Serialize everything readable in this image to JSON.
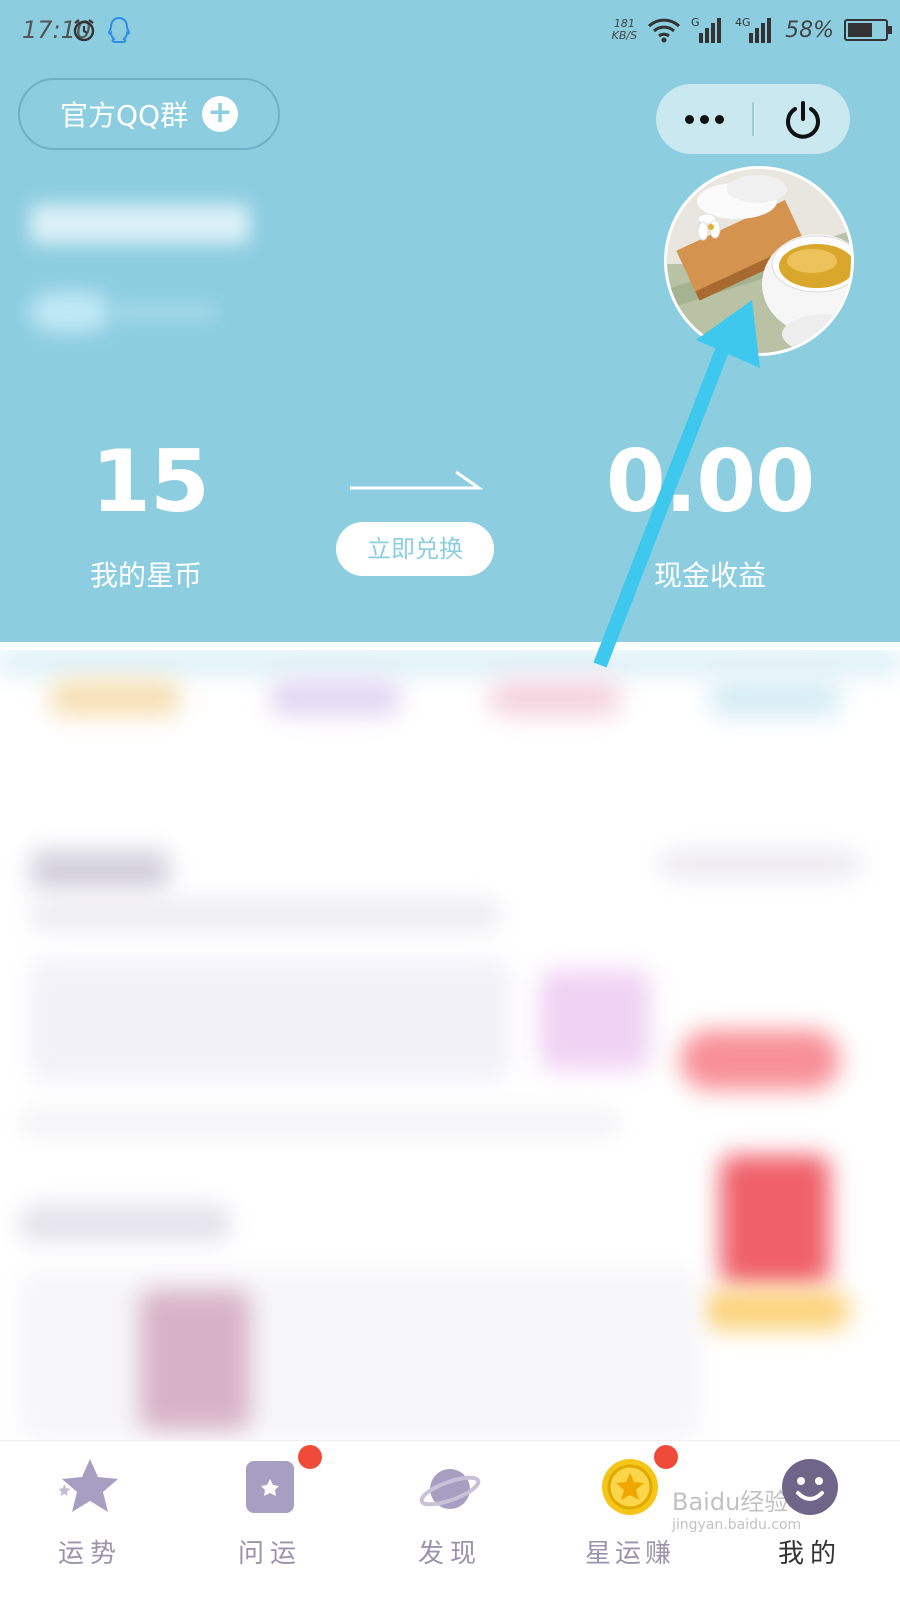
{
  "status_bar": {
    "time": "17:10",
    "speed_value": "181",
    "speed_unit": "KB/S",
    "battery": "58%"
  },
  "header": {
    "qq_group_label": "官方QQ群",
    "more_icon": "more-icon",
    "power_icon": "power-icon",
    "coins_value": "15",
    "coins_label": "我的星币",
    "exchange_label": "立即兑换",
    "cash_value": "0.00",
    "cash_label": "现金收益"
  },
  "tabs": [
    {
      "label": "运势",
      "icon": "star-icon",
      "badge": false
    },
    {
      "label": "问运",
      "icon": "question-card-icon",
      "badge": true
    },
    {
      "label": "发现",
      "icon": "planet-icon",
      "badge": false
    },
    {
      "label": "星运赚",
      "icon": "gold-coin-icon",
      "badge": true
    },
    {
      "label": "我的",
      "icon": "smiley-icon",
      "badge": false
    }
  ],
  "watermark": {
    "brand": "Baidu经验",
    "url": "jingyan.baidu.com"
  },
  "colors": {
    "header_bg": "#8ccde0",
    "pointer_arrow": "#3fc8ee",
    "badge": "#ef4a3a",
    "tab_icon": "#a79fc1"
  }
}
